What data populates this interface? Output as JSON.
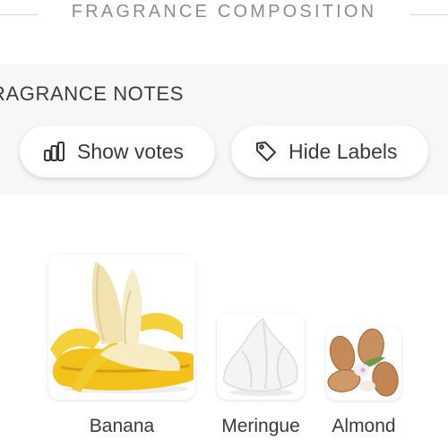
{
  "header": {
    "section_title": "FRAGRANCE COMPOSITION"
  },
  "notes_panel": {
    "heading": "RAGRANCE NOTES",
    "buttons": {
      "show_votes": {
        "label": "Show votes",
        "icon": "bar-chart-icon"
      },
      "hide_labels": {
        "label": "Hide Labels",
        "icon": "tag-icon"
      }
    }
  },
  "notes": [
    {
      "label": "Banana",
      "icon": "banana-image"
    },
    {
      "label": "Meringue",
      "icon": "meringue-image"
    },
    {
      "label": "Almond",
      "icon": "almond-image"
    }
  ],
  "colors": {
    "banana_yellow": "#f2c21b",
    "meringue_white": "#f3f3f3",
    "almond_brown": "#c48a58"
  }
}
